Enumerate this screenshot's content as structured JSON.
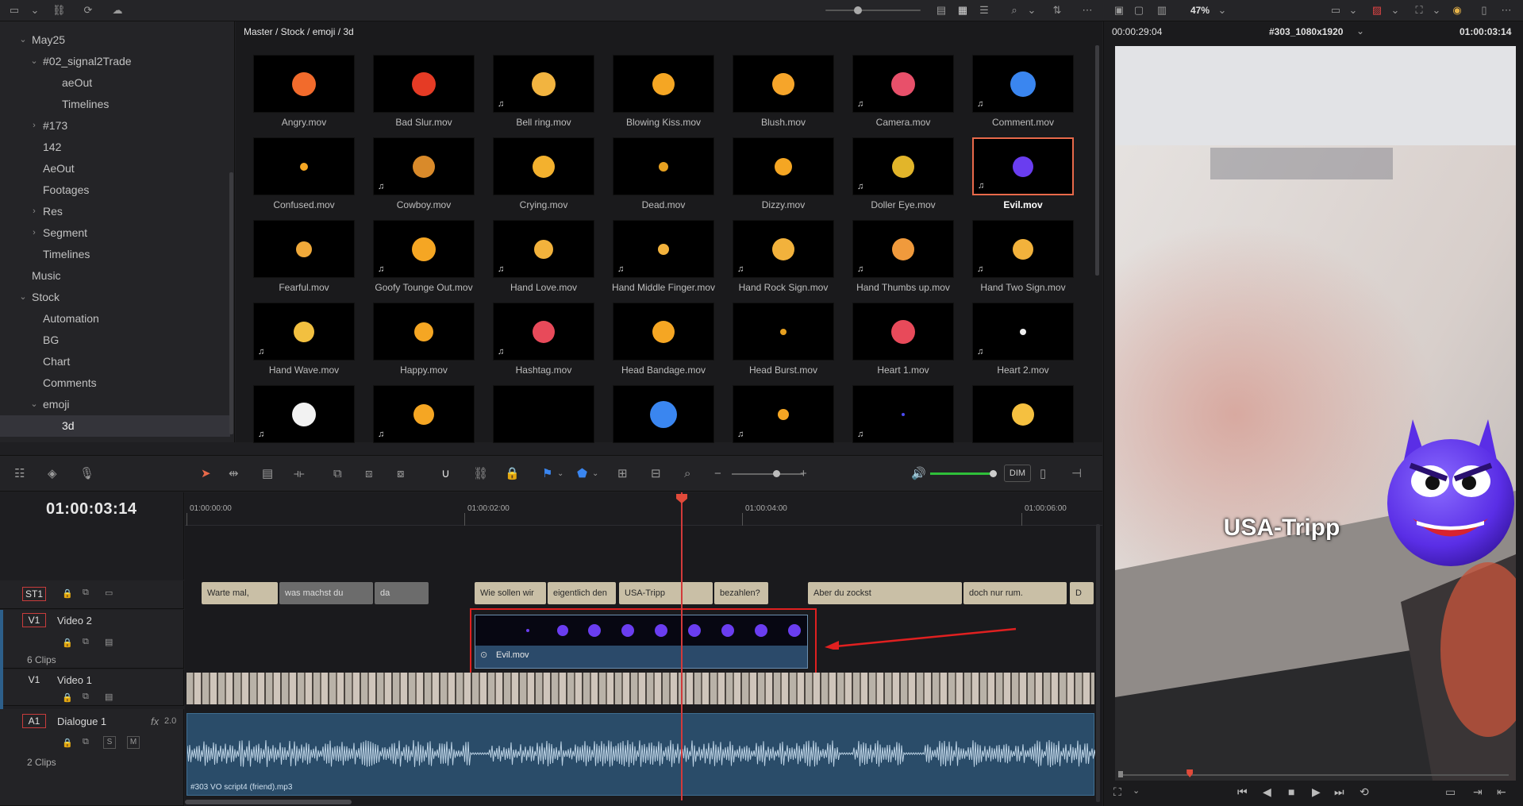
{
  "toolbar": {
    "zoom_level": "47%"
  },
  "tree": {
    "items": [
      {
        "label": "May25",
        "indent": 1,
        "chevron": "down"
      },
      {
        "label": "#02_signal2Trade",
        "indent": 2,
        "chevron": "down"
      },
      {
        "label": "aeOut",
        "indent": 3,
        "chevron": ""
      },
      {
        "label": "Timelines",
        "indent": 3,
        "chevron": ""
      },
      {
        "label": "#173",
        "indent": 2,
        "chevron": "right"
      },
      {
        "label": "142",
        "indent": 2,
        "chevron": ""
      },
      {
        "label": "AeOut",
        "indent": 2,
        "chevron": ""
      },
      {
        "label": "Footages",
        "indent": 2,
        "chevron": ""
      },
      {
        "label": "Res",
        "indent": 2,
        "chevron": "right"
      },
      {
        "label": "Segment",
        "indent": 2,
        "chevron": "right"
      },
      {
        "label": "Timelines",
        "indent": 2,
        "chevron": ""
      },
      {
        "label": "Music",
        "indent": 1,
        "chevron": ""
      },
      {
        "label": "Stock",
        "indent": 1,
        "chevron": "down"
      },
      {
        "label": "Automation",
        "indent": 2,
        "chevron": ""
      },
      {
        "label": "BG",
        "indent": 2,
        "chevron": ""
      },
      {
        "label": "Chart",
        "indent": 2,
        "chevron": ""
      },
      {
        "label": "Comments",
        "indent": 2,
        "chevron": ""
      },
      {
        "label": "emoji",
        "indent": 2,
        "chevron": "down"
      },
      {
        "label": "3d",
        "indent": 3,
        "chevron": "",
        "selected": true
      }
    ]
  },
  "pool": {
    "path": "Master / Stock / emoji / 3d",
    "clips": [
      {
        "name": "Angry.mov",
        "color": "#f26b2c",
        "size": 30,
        "audio": false
      },
      {
        "name": "Bad Slur.mov",
        "color": "#e53b25",
        "size": 30,
        "audio": false
      },
      {
        "name": "Bell ring.mov",
        "color": "#f2b440",
        "size": 30,
        "audio": true
      },
      {
        "name": "Blowing Kiss.mov",
        "color": "#f5a623",
        "size": 28,
        "audio": false
      },
      {
        "name": "Blush.mov",
        "color": "#f6a52a",
        "size": 28,
        "audio": false
      },
      {
        "name": "Camera.mov",
        "color": "#e8506a",
        "size": 30,
        "audio": true
      },
      {
        "name": "Comment.mov",
        "color": "#3a86f0",
        "size": 32,
        "audio": true
      },
      {
        "name": "Confused.mov",
        "color": "#f5a623",
        "size": 10,
        "audio": false
      },
      {
        "name": "Cowboy.mov",
        "color": "#d98a2a",
        "size": 28,
        "audio": true
      },
      {
        "name": "Crying.mov",
        "color": "#f3b12e",
        "size": 28,
        "audio": false
      },
      {
        "name": "Dead.mov",
        "color": "#e6a020",
        "size": 12,
        "audio": false
      },
      {
        "name": "Dizzy.mov",
        "color": "#f5a623",
        "size": 22,
        "audio": false
      },
      {
        "name": "Doller Eye.mov",
        "color": "#e2b52a",
        "size": 28,
        "audio": true
      },
      {
        "name": "Evil.mov",
        "color": "#6a3df0",
        "size": 26,
        "audio": true,
        "selected": true
      },
      {
        "name": "Fearful.mov",
        "color": "#f0a93a",
        "size": 20,
        "audio": false
      },
      {
        "name": "Goofy Tounge Out.mov",
        "color": "#f5a623",
        "size": 30,
        "audio": true
      },
      {
        "name": "Hand Love.mov",
        "color": "#f2b23c",
        "size": 24,
        "audio": true
      },
      {
        "name": "Hand Middle Finger.mov",
        "color": "#f2b23c",
        "size": 14,
        "audio": true
      },
      {
        "name": "Hand Rock Sign.mov",
        "color": "#f2b23c",
        "size": 28,
        "audio": true
      },
      {
        "name": "Hand Thumbs up.mov",
        "color": "#f09a3c",
        "size": 28,
        "audio": true
      },
      {
        "name": "Hand Two Sign.mov",
        "color": "#f2b23c",
        "size": 26,
        "audio": true
      },
      {
        "name": "Hand Wave.mov",
        "color": "#f2c040",
        "size": 26,
        "audio": true
      },
      {
        "name": "Happy.mov",
        "color": "#f5a623",
        "size": 24,
        "audio": false
      },
      {
        "name": "Hashtag.mov",
        "color": "#e84a5a",
        "size": 28,
        "audio": true
      },
      {
        "name": "Head Bandage.mov",
        "color": "#f5a623",
        "size": 28,
        "audio": false
      },
      {
        "name": "Head Burst.mov",
        "color": "#e6a020",
        "size": 8,
        "audio": false
      },
      {
        "name": "Heart 1.mov",
        "color": "#e84a5a",
        "size": 30,
        "audio": false
      },
      {
        "name": "Heart 2.mov",
        "color": "#eeeeee",
        "size": 8,
        "audio": true
      },
      {
        "name": "",
        "color": "#f2f2f2",
        "size": 30,
        "audio": true
      },
      {
        "name": "",
        "color": "#f5a623",
        "size": 26,
        "audio": true
      },
      {
        "name": "",
        "color": "#000000",
        "size": 0,
        "audio": false
      },
      {
        "name": "",
        "color": "#3a86f0",
        "size": 34,
        "audio": false
      },
      {
        "name": "",
        "color": "#f5a623",
        "size": 14,
        "audio": true
      },
      {
        "name": "",
        "color": "#4a4af0",
        "size": 4,
        "audio": true
      },
      {
        "name": "",
        "color": "#f5c040",
        "size": 28,
        "audio": false
      }
    ]
  },
  "viewer": {
    "source_timecode": "00:00:29:04",
    "timeline_name": "#303_1080x1920",
    "record_timecode": "01:00:03:14",
    "caption": "USA-Tripp",
    "scrub_position": 0.18
  },
  "timeline": {
    "timecode": "01:00:03:14",
    "ruler_labels": [
      "01:00:00:00",
      "01:00:02:00",
      "01:00:04:00",
      "01:00:06:00"
    ],
    "dim_label": "DIM",
    "tracks": {
      "st1": {
        "id": "ST1"
      },
      "v2": {
        "id": "V1",
        "name": "Video 2",
        "clips_count": "6 Clips"
      },
      "v1": {
        "id": "V1",
        "name": "Video 1"
      },
      "a1": {
        "id": "A1",
        "name": "Dialogue 1",
        "fx": "fx",
        "level": "2.0",
        "clips_count": "2 Clips",
        "solo": "S",
        "mute": "M"
      }
    },
    "subtitles": [
      {
        "text": "Warte mal,",
        "dim": false
      },
      {
        "text": "was machst du",
        "dim": true
      },
      {
        "text": "da",
        "dim": true
      },
      {
        "text": "Wie sollen wir",
        "dim": false
      },
      {
        "text": "eigentlich den",
        "dim": false
      },
      {
        "text": "USA-Tripp",
        "dim": false
      },
      {
        "text": "bezahlen?",
        "dim": false
      },
      {
        "text": "Aber du zockst",
        "dim": false
      },
      {
        "text": "doch nur rum.",
        "dim": false
      },
      {
        "text": "D",
        "dim": false
      }
    ],
    "evil_clip_label": "Evil.mov",
    "audio_clip_label": "#303 VO script4 (friend).mp3"
  },
  "colors": {
    "accent_red": "#e02020",
    "playhead": "#d23a3a",
    "selection_border": "#e8694a",
    "video_clip": "#2b4a6a",
    "subtitle_clip": "#c9bfa6"
  }
}
